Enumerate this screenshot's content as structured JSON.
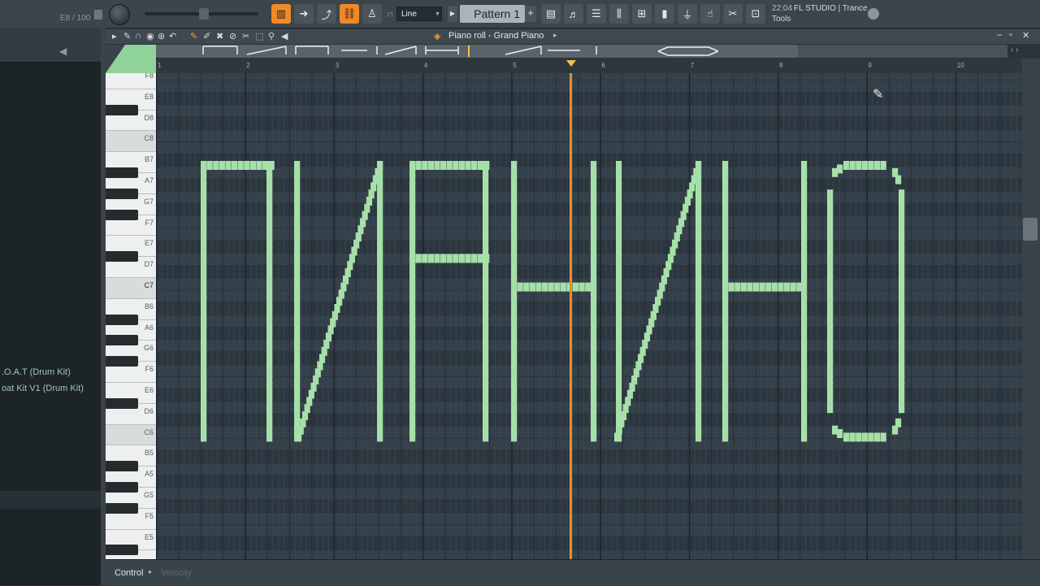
{
  "toolbar": {
    "hint_text": "E8 / 100",
    "mode_select": "Line",
    "pattern_label": "Pattern 1",
    "time": "22:04",
    "app_title": "FL STUDIO | Trance",
    "app_subtitle": "Tools",
    "buttons": [
      "piano-roll-icon",
      "arrow-right-icon",
      "draw-curve-icon",
      "link-icon",
      "stamp-icon",
      "playlist-icon",
      "step-seq-icon",
      "channel-rack-icon",
      "mixer-icon",
      "browser-icon",
      "template-icon",
      "plug-icon",
      "touch-icon",
      "tools-icon",
      "cart-icon"
    ],
    "active_buttons": [
      "piano-roll-icon",
      "link-icon"
    ]
  },
  "browser": {
    "items": [
      ".O.A.T (Drum Kit)",
      "oat Kit V1 (Drum Kit)"
    ]
  },
  "piano_roll": {
    "title": "Piano roll - Grand Piano",
    "bar_numbers": [
      "1",
      "2",
      "3",
      "4",
      "5",
      "6",
      "7",
      "8",
      "9",
      "10"
    ],
    "key_labels": [
      {
        "label": "F8"
      },
      {
        "label": "E8"
      },
      {
        "label": "D8"
      },
      {
        "label": "C8"
      },
      {
        "label": "B7"
      },
      {
        "label": "A7"
      },
      {
        "label": "G7"
      },
      {
        "label": "F7"
      },
      {
        "label": "E7"
      },
      {
        "label": "D7"
      },
      {
        "label": "C7",
        "highlight": true
      },
      {
        "label": "B6"
      },
      {
        "label": "A6"
      },
      {
        "label": "G6"
      },
      {
        "label": "F6"
      },
      {
        "label": "E6"
      },
      {
        "label": "D6"
      },
      {
        "label": "C6"
      },
      {
        "label": "B5"
      },
      {
        "label": "A5"
      },
      {
        "label": "G5"
      },
      {
        "label": "F5"
      },
      {
        "label": "E5"
      }
    ],
    "note_color": "#a6e0a8",
    "playhead_color": "#e98f2c",
    "control_label": "Control",
    "velocity_label": "Velocity"
  }
}
